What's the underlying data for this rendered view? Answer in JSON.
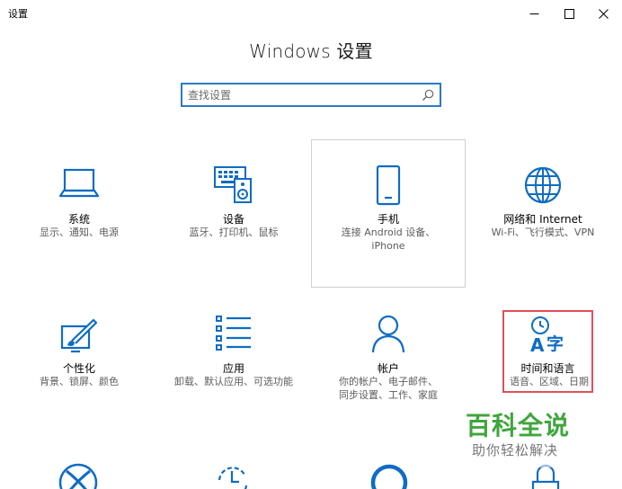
{
  "window": {
    "title": "设置"
  },
  "heading": "Windows 设置",
  "search": {
    "placeholder": "查找设置"
  },
  "tiles": [
    {
      "label": "系统",
      "desc": "显示、通知、电源",
      "icon": "laptop-icon"
    },
    {
      "label": "设备",
      "desc": "蓝牙、打印机、鼠标",
      "icon": "keyboard-speaker-icon"
    },
    {
      "label": "手机",
      "desc": "连接 Android 设备、iPhone",
      "icon": "phone-icon"
    },
    {
      "label": "网络和 Internet",
      "desc": "Wi-Fi、飞行模式、VPN",
      "icon": "globe-icon"
    },
    {
      "label": "个性化",
      "desc": "背景、锁屏、颜色",
      "icon": "paint-brush-icon"
    },
    {
      "label": "应用",
      "desc": "卸载、默认应用、可选功能",
      "icon": "apps-list-icon"
    },
    {
      "label": "帐户",
      "desc": "你的帐户、电子邮件、同步设置、工作、家庭",
      "icon": "person-icon"
    },
    {
      "label": "时间和语言",
      "desc": "语音、区域、日期",
      "icon": "time-language-icon"
    }
  ],
  "watermark": {
    "title": "百科全说",
    "subtitle": "助你轻松解决"
  },
  "colors": {
    "accent": "#0f6cc4",
    "selection": "#e0505a",
    "watermark": "#3fa63c"
  }
}
